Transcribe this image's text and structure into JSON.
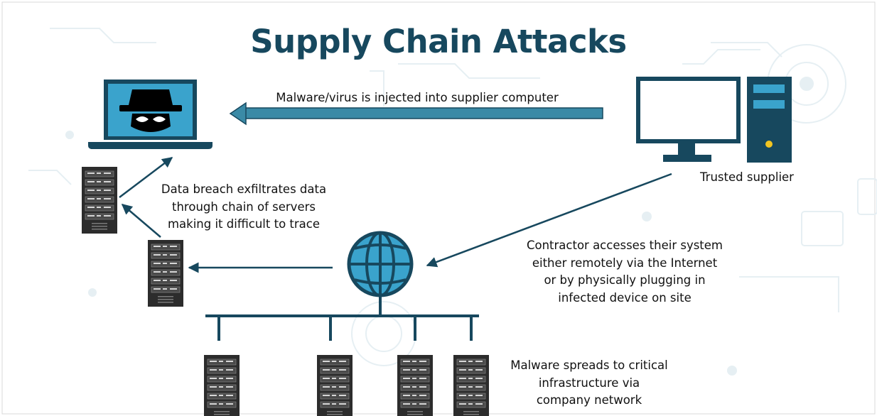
{
  "title": "Supply Chain Attacks",
  "captions": {
    "malware_injected": "Malware/virus is injected into supplier computer",
    "trusted_supplier": "Trusted supplier",
    "data_breach": [
      "Data breach exfiltrates data",
      "through chain of servers",
      "making it difficult to trace"
    ],
    "contractor_access": [
      "Contractor accesses their system",
      "either remotely via the Internet",
      "or by physically plugging in",
      "infected device on site"
    ],
    "malware_spreads": [
      "Malware spreads to critical",
      "infrastructure via",
      "company network"
    ]
  },
  "icons": {
    "attacker": "hacker-laptop-icon",
    "supplier": "desktop-computer-icon",
    "internet": "globe-icon",
    "server": "server-rack-icon"
  },
  "colors": {
    "title": "#17485e",
    "dark_blue": "#17485e",
    "screen_blue": "#3aa3cc",
    "server_dark": "#2c2c2c",
    "accent_yellow": "#f2c521"
  }
}
